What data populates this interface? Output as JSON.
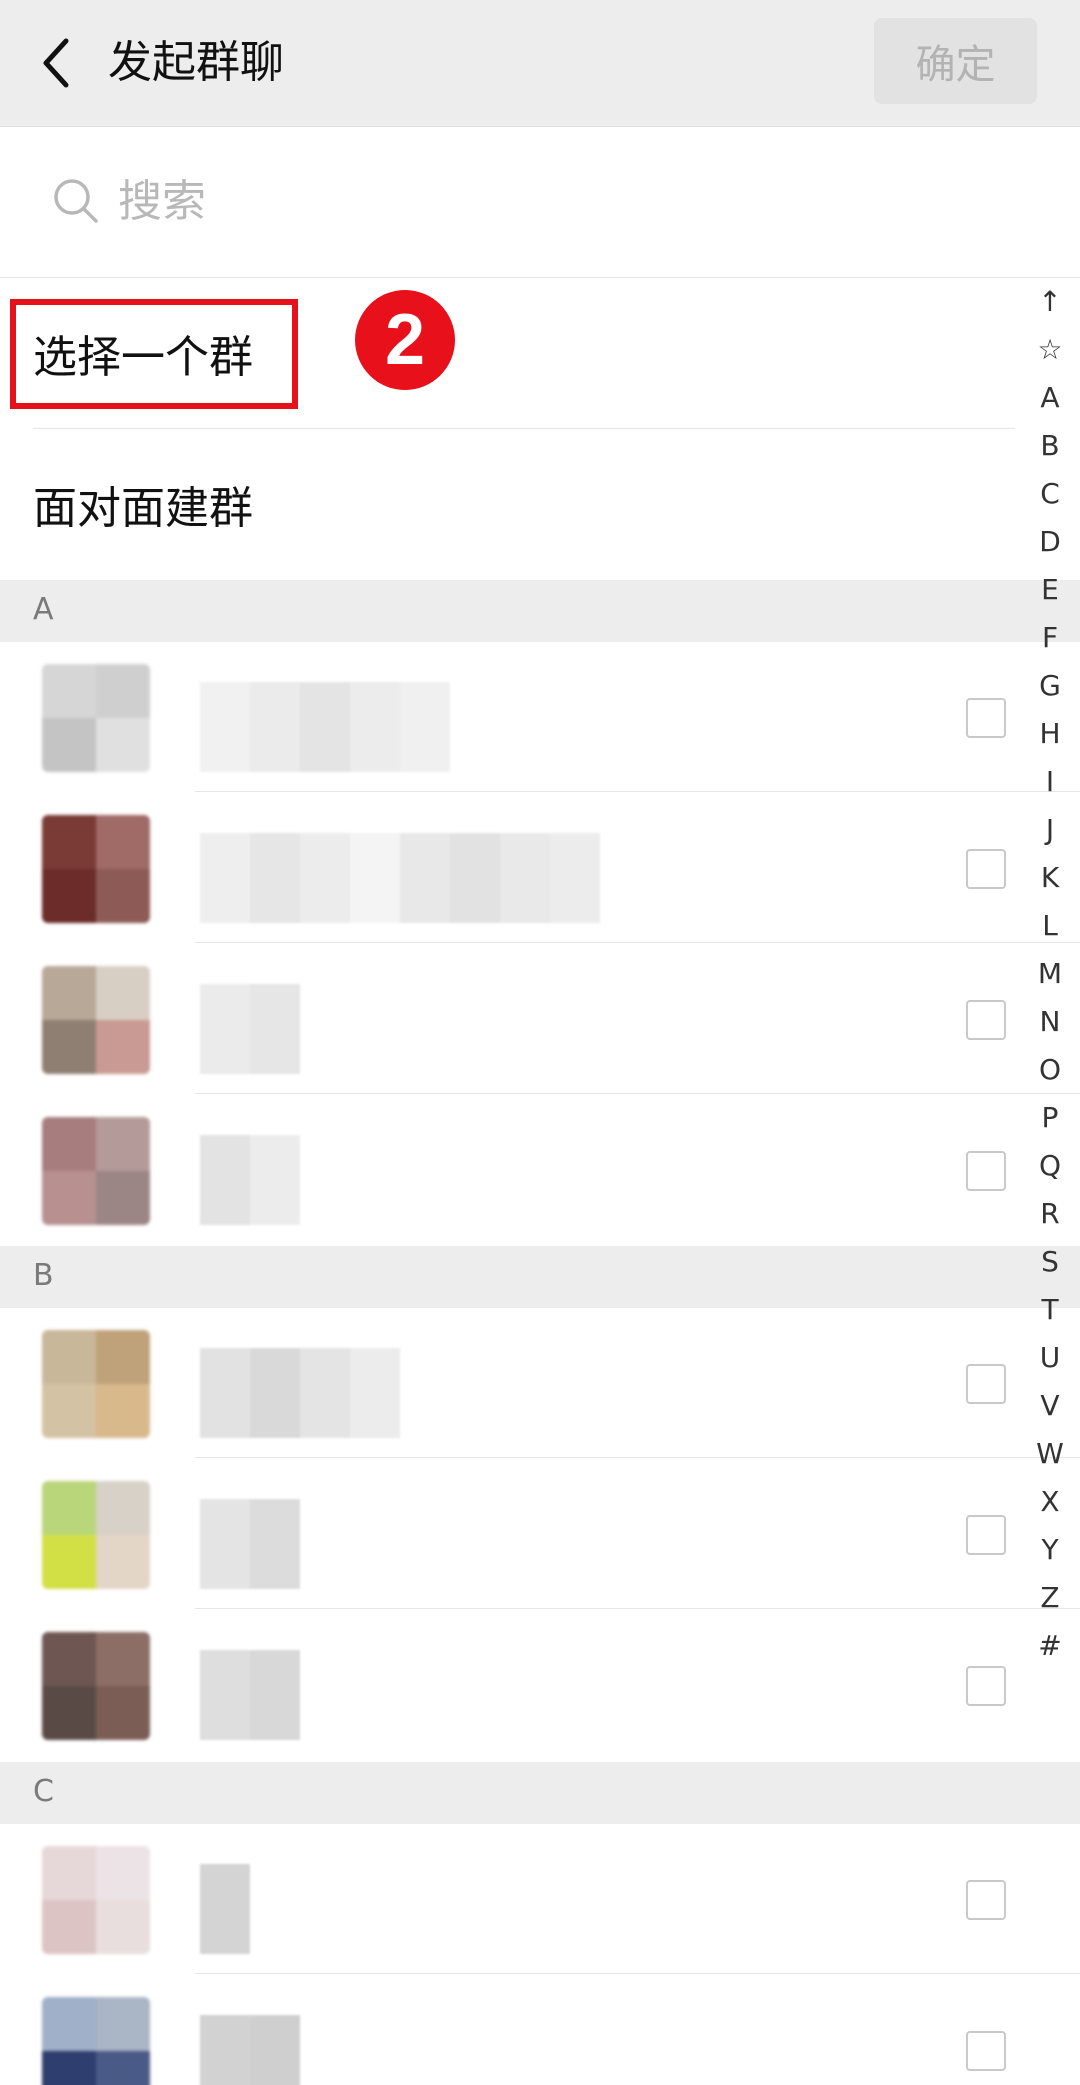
{
  "header": {
    "title": "发起群聊",
    "confirm_label": "确定"
  },
  "search": {
    "placeholder": "搜索"
  },
  "actions": [
    {
      "label": "选择一个群"
    },
    {
      "label": "面对面建群"
    }
  ],
  "annotation": {
    "step_number": "2"
  },
  "sections": [
    {
      "letter": "A"
    },
    {
      "letter": "B"
    },
    {
      "letter": "C"
    }
  ],
  "index_bar": [
    "↑",
    "☆",
    "A",
    "B",
    "C",
    "D",
    "E",
    "F",
    "G",
    "H",
    "I",
    "J",
    "K",
    "L",
    "M",
    "N",
    "O",
    "P",
    "Q",
    "R",
    "S",
    "T",
    "U",
    "V",
    "W",
    "X",
    "Y",
    "Z",
    "#"
  ],
  "colors": {
    "highlight_red": "#e5121b",
    "header_bg": "#ededed",
    "confirm_disabled_text": "#b3b3b3"
  }
}
